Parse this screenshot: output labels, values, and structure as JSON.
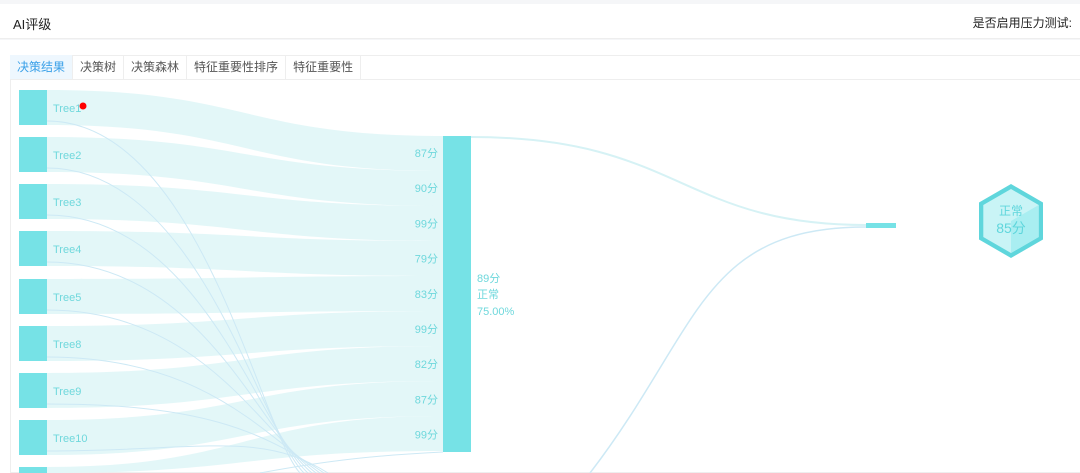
{
  "header": {
    "title": "AI评级",
    "stress_test_label": "是否启用压力测试:"
  },
  "tabs": [
    {
      "label": "决策结果",
      "active": true
    },
    {
      "label": "决策树"
    },
    {
      "label": "决策森林"
    },
    {
      "label": "特征重要性排序"
    },
    {
      "label": "特征重要性"
    }
  ],
  "colors": {
    "node": "#76e2e6",
    "flow": "#e1f7f8",
    "link": "#cde9f5",
    "marker": "#ff0000"
  },
  "sankey": {
    "trees": [
      "Tree1",
      "Tree2",
      "Tree3",
      "Tree4",
      "Tree5",
      "Tree8",
      "Tree9",
      "Tree10"
    ],
    "scores": [
      "87分",
      "90分",
      "99分",
      "79分",
      "83分",
      "99分",
      "82分",
      "87分",
      "99分"
    ],
    "aggregate": {
      "score": "89分",
      "status": "正常",
      "percent": "75.00%"
    },
    "result": {
      "status": "正常",
      "score": "85分"
    }
  }
}
